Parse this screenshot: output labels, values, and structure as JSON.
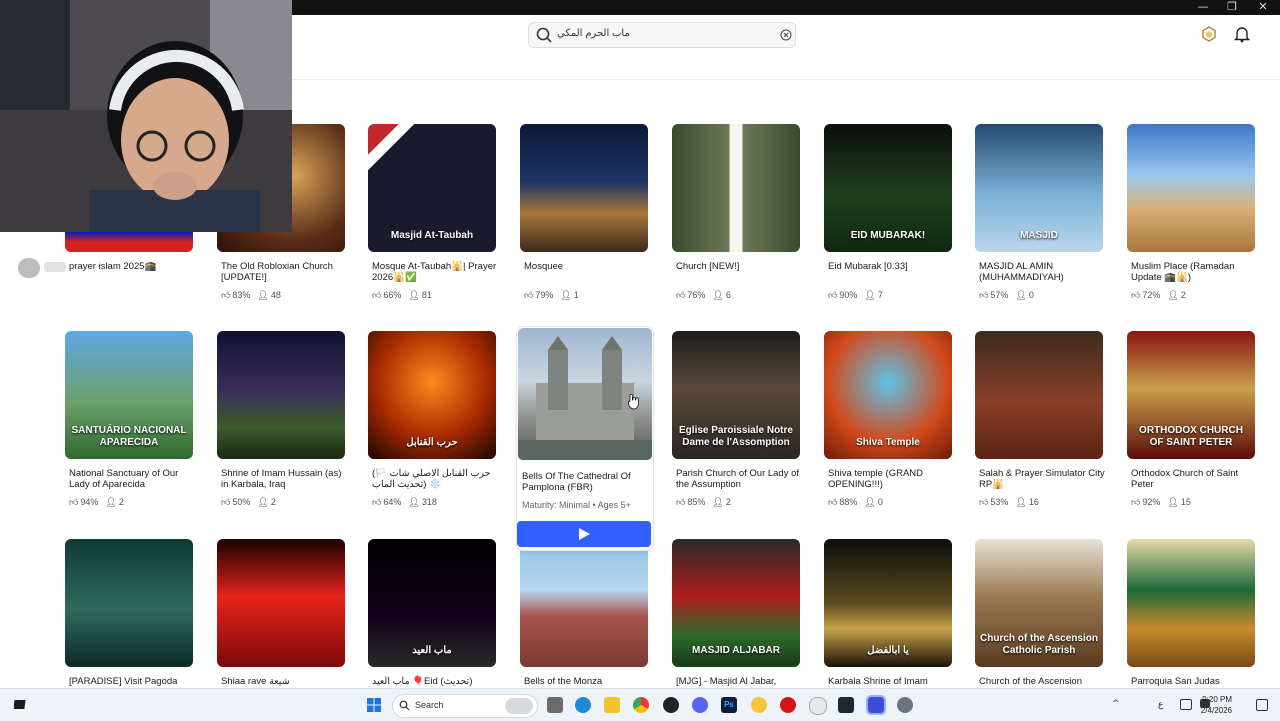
{
  "search": {
    "query": "ماب الحرم المكي"
  },
  "window_controls": [
    "—",
    "❐",
    "✕"
  ],
  "webcam_overlay": {
    "tag": "prayer islam 2025🕋"
  },
  "rows": [
    [
      {
        "title": "prayer islam 2025🕋",
        "rating": "",
        "players": "",
        "bg": "linear-gradient(#c9c9c9,#0c1fb8 85%,#d32020 92%)"
      },
      {
        "title": "The Old Robloxian Church [UPDATE!]",
        "rating": "83%",
        "players": "48",
        "bg": "radial-gradient(circle at 60% 40%,#d7a55a,#5b2d16 60%,#2a1208)"
      },
      {
        "title": "Mosque At-Taubah🕌| Prayer 2026🕌✅",
        "rating": "66%",
        "players": "81",
        "bg": "linear-gradient(135deg,#c0282d 0 12%,#fff 12% 18%,#1a1a2e 18%)",
        "caption": "Masjid At-Taubah"
      },
      {
        "title": "Mosquee",
        "rating": "79%",
        "players": "1",
        "bg": "linear-gradient(#0b1836,#1e3466 45%,#a8773a 70%,#3b2a1a)"
      },
      {
        "title": "Church [NEW!]",
        "rating": "76%",
        "players": "6",
        "bg": "linear-gradient(90deg,#3a4a2e,#6a7a58 45%,#f4f4ef 45% 55%,#6a7a58 55%,#3a4a2e)"
      },
      {
        "title": "Eid Mubarak [0.33]",
        "rating": "90%",
        "players": "7",
        "bg": "linear-gradient(#0b0d0b,#20401e 55%,#0e2a0e)",
        "caption": "EID MUBARAK!"
      },
      {
        "title": "MASJID AL AMIN (MUHAMMADIYAH)",
        "rating": "57%",
        "players": "0",
        "bg": "linear-gradient(#23496f,#7cb2d8 55%,#b9d6ea)",
        "caption": "MASJID"
      },
      {
        "title": "Muslim Place (Ramadan Update 🕋🕌)",
        "rating": "72%",
        "players": "2",
        "bg": "linear-gradient(#3b78c7,#9ac8f0 40%,#d8b27a 65%,#a9763c)"
      }
    ],
    [
      {
        "title": "National Sanctuary of Our Lady of Aparecida",
        "rating": "94%",
        "players": "2",
        "bg": "linear-gradient(#5ea8e6,#6ba06b 55%,#2f6a2f)",
        "caption": "SANTUÁRIO NACIONAL APARECIDA"
      },
      {
        "title": "Shrine of Imam Hussain (as) in Karbala, Iraq",
        "rating": "50%",
        "players": "2",
        "bg": "linear-gradient(#0e1230,#3a2c5a 45%,#3b5c2a 75%,#1a2a12)"
      },
      {
        "title": "(حرب القنابل الاصلي شات 🏳️(تحديث الماب ❄️",
        "rating": "64%",
        "players": "318",
        "bg": "radial-gradient(circle at 50% 40%,#ff8a1e,#a72a00 55%,#1a0500)",
        "caption": "حرب القنابل"
      },
      {
        "title": "Bells Of The Cathedral Of Pamplona (FBR)",
        "rating": "",
        "players": "",
        "bg": "linear-gradient(#9fb6cf,#c9d5e1 40%,#8b8d8a 70%,#4e5a52)"
      },
      {
        "title": "Parish Church of Our Lady of the Assumption",
        "rating": "85%",
        "players": "2",
        "bg": "linear-gradient(#1c1c1c,#5a4a3a 45%,#2a2622)",
        "caption": "Eglise Paroissiale Notre Dame de l'Assomption"
      },
      {
        "title": "Shiva temple (GRAND OPENING!!!)",
        "rating": "88%",
        "players": "0",
        "bg": "radial-gradient(circle at 50% 40%,#5ec3e8,#d2491a 60%,#6a1a0a)",
        "caption": "Shiva Temple"
      },
      {
        "title": "Salah & Prayer Simulator City RP🕌",
        "rating": "53%",
        "players": "16",
        "bg": "linear-gradient(#3c2b20,#8a3f27 55%,#5a2414)"
      },
      {
        "title": "Orthodox Church of Saint Peter",
        "rating": "92%",
        "players": "15",
        "bg": "linear-gradient(#8a1414,#c9a14a 45%,#5a0c0c)",
        "caption": "ORTHODOX CHURCH OF SAINT PETER"
      }
    ],
    [
      {
        "title": "[PARADISE] Visit Pagoda",
        "rating": "",
        "players": "",
        "bg": "linear-gradient(#0f3b35,#2f6b5c 55%,#0a2a26)"
      },
      {
        "title": "Shiaa rave شيعة",
        "rating": "",
        "players": "",
        "bg": "linear-gradient(#1a0000,#e8231c 45%,#7a0a0a)"
      },
      {
        "title": "ماب العيد 🎈Eid (تحديث)",
        "rating": "",
        "players": "",
        "bg": "linear-gradient(#000,#120019 60%,#2a2a2a)",
        "caption": "ماب العيد"
      },
      {
        "title": "Bells of the Monza",
        "rating": "",
        "players": "",
        "bg": "linear-gradient(#8ec1e8,#b7d6ee 40%,#a9544c 60%,#7a3a34)"
      },
      {
        "title": "[MJG] - Masjid Al Jabar,",
        "rating": "",
        "players": "",
        "bg": "linear-gradient(#2a2a2a,#b01c1c 45%,#2c6a2a 75%,#1a3a18)",
        "caption": "MASJID ALJABAR"
      },
      {
        "title": "Karbala Shrine of Imam",
        "rating": "",
        "players": "",
        "bg": "linear-gradient(#0c0c0c,#5a4a1e 50%,#c9a24a 70%,#1a1208)",
        "caption": "يا ابالفضل"
      },
      {
        "title": "Church of the Ascension",
        "rating": "",
        "players": "",
        "bg": "linear-gradient(#e8e2d6,#9a7a52 45%,#5a3a20)",
        "caption": "Church of the Ascension Catholic Parish"
      },
      {
        "title": "Parroquia San Judas",
        "rating": "",
        "players": "",
        "bg": "linear-gradient(#e9d9a6,#1c6a3a 40%,#c98a2a 70%,#7a4a18)"
      }
    ]
  ],
  "hover_card": {
    "maturity": "Maturity: Minimal • Ages 5+"
  },
  "taskbar": {
    "search_label": "Search",
    "lang": "ع",
    "time": "9:20 PM",
    "date": "2/4/2026"
  }
}
